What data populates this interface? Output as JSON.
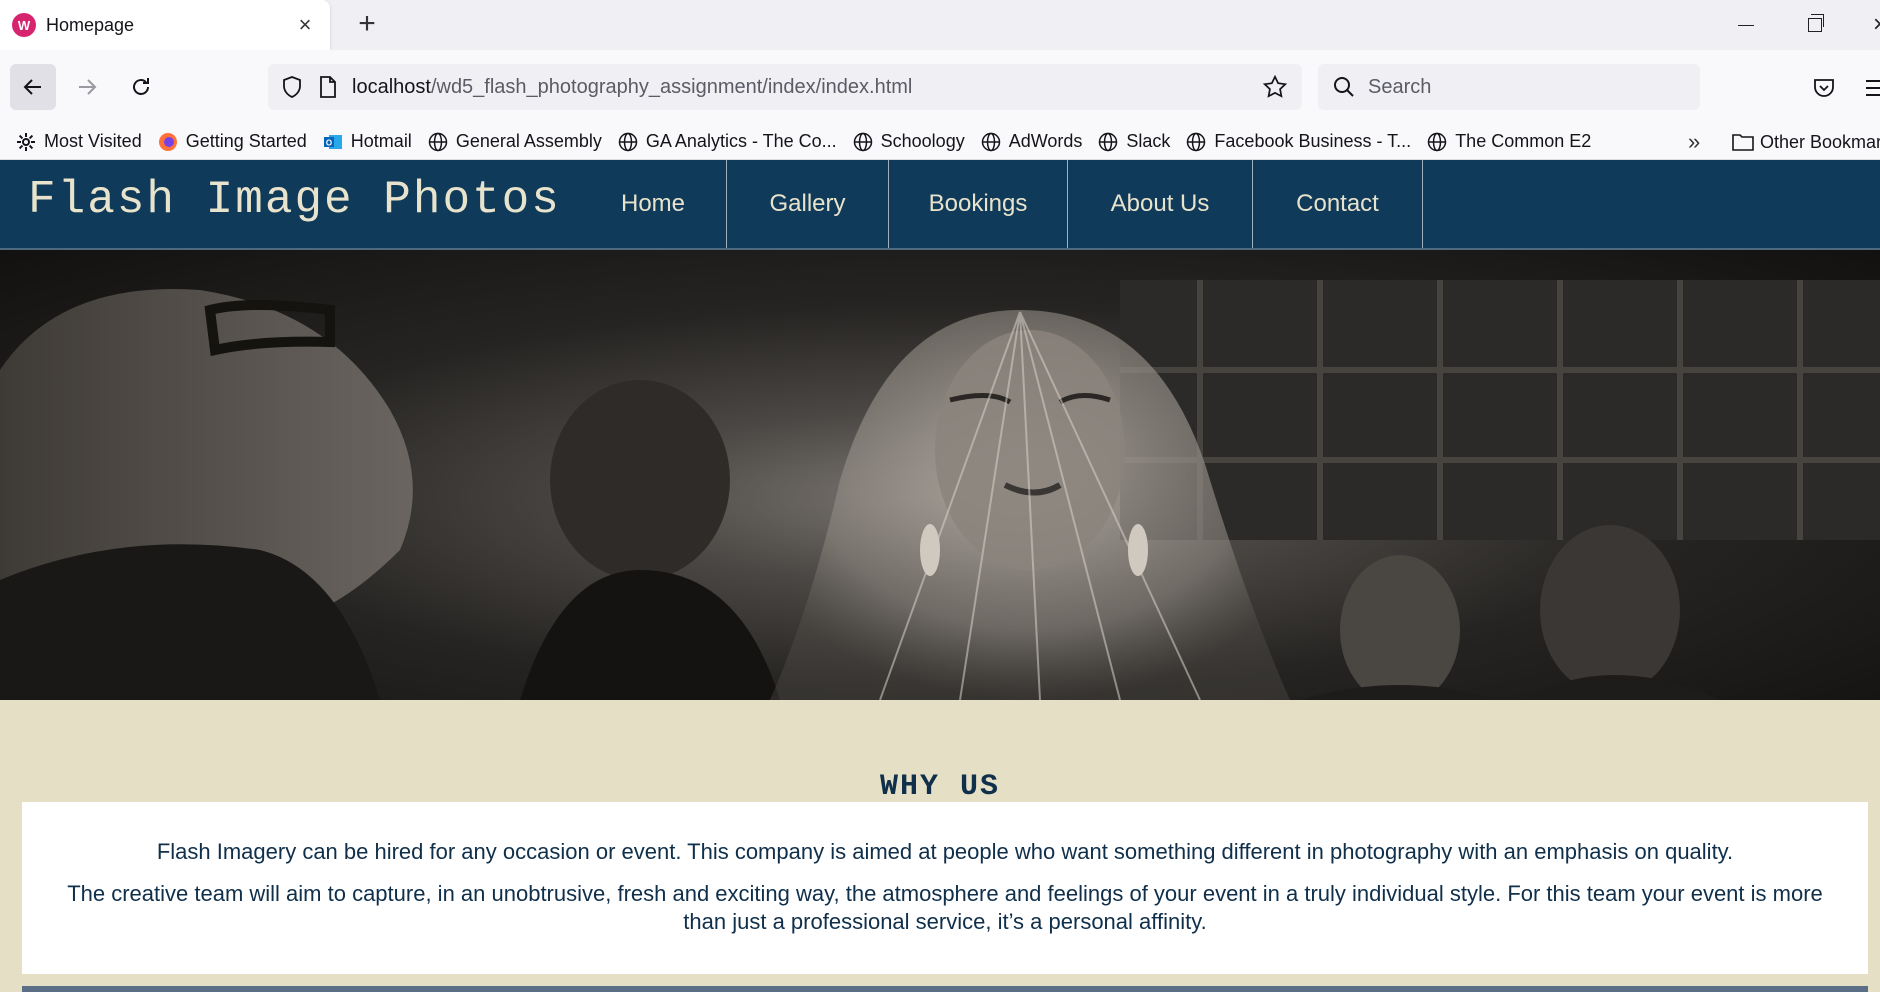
{
  "browser": {
    "tab_title": "Homepage",
    "url_host": "localhost",
    "url_path": "/wd5_flash_photography_assignment/index/index.html",
    "search_placeholder": "Search",
    "bookmarks": [
      {
        "label": "Most Visited",
        "icon": "gear-icon"
      },
      {
        "label": "Getting Started",
        "icon": "firefox-icon"
      },
      {
        "label": "Hotmail",
        "icon": "outlook-icon"
      },
      {
        "label": "General Assembly",
        "icon": "globe-icon"
      },
      {
        "label": "GA Analytics - The Co...",
        "icon": "globe-icon"
      },
      {
        "label": "Schoology",
        "icon": "globe-icon"
      },
      {
        "label": "AdWords",
        "icon": "globe-icon"
      },
      {
        "label": "Slack",
        "icon": "globe-icon"
      },
      {
        "label": "Facebook Business - T...",
        "icon": "globe-icon"
      },
      {
        "label": "The Common E2",
        "icon": "globe-icon"
      }
    ],
    "other_bookmarks": "Other Bookmarks"
  },
  "site": {
    "brand": "Flash Image Photos",
    "menu": [
      "Home",
      "Gallery",
      "Bookings",
      "About Us",
      "Contact"
    ]
  },
  "why_us": {
    "title": "WHY US",
    "paragraph_1": "Flash Imagery can be hired for any occasion or event. This company is aimed at people who want something different in photography with an emphasis on quality.",
    "paragraph_2": "The creative team will aim to capture, in an unobtrusive, fresh and exciting way, the atmosphere and feelings of your event in a truly individual style. For this team your event is more than just a professional service, it’s a personal affinity."
  },
  "colors": {
    "header_bg": "#0f3a59",
    "page_bg": "#e5dfc5",
    "text_dark": "#0f2f4a",
    "accent_favicon": "#d6246e"
  }
}
